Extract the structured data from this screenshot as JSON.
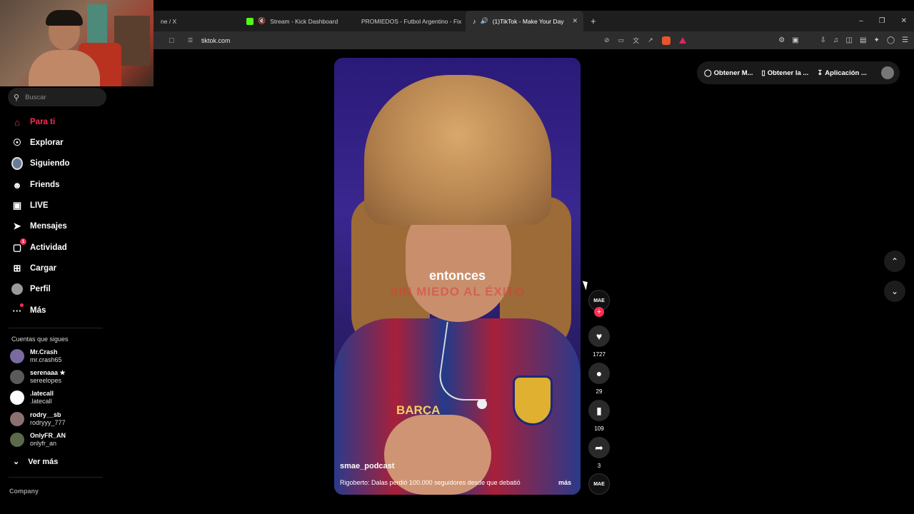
{
  "browser": {
    "tabs": [
      {
        "label": "ne / X",
        "icon": "x-icon"
      },
      {
        "label": "Stream - Kick Dashboard",
        "icon": "kick-icon"
      },
      {
        "label": "PROMIEDOS - Futbol Argentino - Fix",
        "icon": "promiedos-icon"
      },
      {
        "label": "(1)TikTok - Make Your Day",
        "icon": "tiktok-icon"
      }
    ],
    "url": "tiktok.com"
  },
  "sidebar": {
    "search_placeholder": "Buscar",
    "nav": [
      {
        "label": "Para ti",
        "icon": "home-icon"
      },
      {
        "label": "Explorar",
        "icon": "compass-icon"
      },
      {
        "label": "Siguiendo",
        "icon": "following-avatar-icon"
      },
      {
        "label": "Friends",
        "icon": "friends-icon"
      },
      {
        "label": "LIVE",
        "icon": "live-icon"
      },
      {
        "label": "Mensajes",
        "icon": "send-icon"
      },
      {
        "label": "Actividad",
        "icon": "activity-icon",
        "badge": "1"
      },
      {
        "label": "Cargar",
        "icon": "upload-icon"
      },
      {
        "label": "Perfil",
        "icon": "profile-avatar-icon"
      },
      {
        "label": "Más",
        "icon": "more-dots-icon"
      }
    ],
    "following_title": "Cuentas que sigues",
    "following": [
      {
        "name": "Mr.Crash",
        "handle": "mr.crash65"
      },
      {
        "name": "serenaaa ★",
        "handle": "sereelopes"
      },
      {
        "name": ".latecall",
        "handle": ".latecall"
      },
      {
        "name": "rodry__sb",
        "handle": "rodryyy_777"
      },
      {
        "name": "OnlyFR_AN",
        "handle": "onlyfr_an"
      }
    ],
    "see_more": "Ver más",
    "company": "Company"
  },
  "top_buttons": {
    "coins": "Obtener M...",
    "app": "Obtener la ...",
    "desktop": "Aplicación ..."
  },
  "video": {
    "caption": "entonces",
    "banner": "SIN MIEDO AL ÉXITO",
    "shirt_text": "BARÇA",
    "username": "smae_podcast",
    "description": "Rigoberto: Dalas perdió 100.000 seguidores desde que debatió",
    "more": "más"
  },
  "actions": {
    "creator_label": "MAE",
    "likes": "1727",
    "comments": "29",
    "saves": "109",
    "shares": "3",
    "sound_label": "MAE"
  },
  "colors": {
    "accent": "#fe2c55",
    "background": "#000000"
  }
}
